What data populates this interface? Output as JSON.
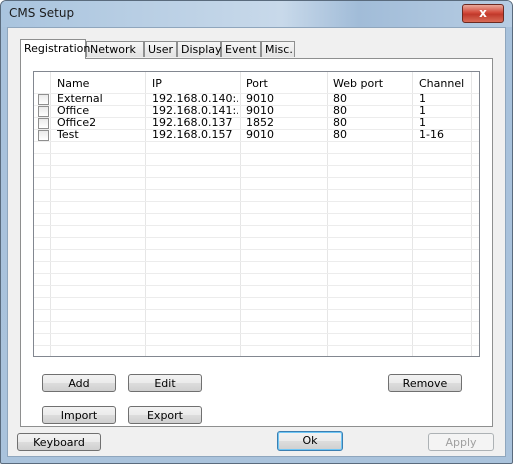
{
  "window": {
    "title": "CMS Setup",
    "close_glyph": "x"
  },
  "tabs": [
    {
      "label": "Registration",
      "active": true
    },
    {
      "label": "Network",
      "active": false
    },
    {
      "label": "User",
      "active": false
    },
    {
      "label": "Display",
      "active": false
    },
    {
      "label": "Event",
      "active": false
    },
    {
      "label": "Misc.",
      "active": false
    }
  ],
  "table": {
    "columns": [
      "Name",
      "IP",
      "Port",
      "Web port",
      "Channel"
    ],
    "rows": [
      {
        "name": "External",
        "ip": "192.168.0.140:...",
        "port": "9010",
        "web_port": "80",
        "channel": "1",
        "checked": false
      },
      {
        "name": "Office",
        "ip": "192.168.0.141:...",
        "port": "9010",
        "web_port": "80",
        "channel": "1",
        "checked": false
      },
      {
        "name": "Office2",
        "ip": "192.168.0.137",
        "port": "1852",
        "web_port": "80",
        "channel": "1",
        "checked": false
      },
      {
        "name": "Test",
        "ip": "192.168.0.157",
        "port": "9010",
        "web_port": "80",
        "channel": "1-16",
        "checked": false
      }
    ]
  },
  "buttons": {
    "add": "Add",
    "edit": "Edit",
    "remove": "Remove",
    "import": "Import",
    "export": "Export",
    "keyboard": "Keyboard",
    "ok": "Ok",
    "apply": "Apply"
  }
}
